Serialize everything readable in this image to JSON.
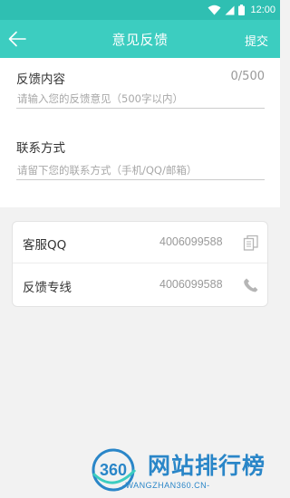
{
  "status_bar": {
    "time": "12:00",
    "icons": [
      "wifi-icon",
      "signal-icon",
      "battery-icon"
    ]
  },
  "app_bar": {
    "title": "意见反馈",
    "submit_label": "提交",
    "back_icon": "arrow-left-icon",
    "color": "#3ccdc0"
  },
  "form": {
    "feedback": {
      "label": "反馈内容",
      "counter": "0/500",
      "value": "",
      "placeholder": "请输入您的反馈意见（500字以内）"
    },
    "contact": {
      "label": "联系方式",
      "value": "",
      "placeholder": "请留下您的联系方式（手机/QQ/邮箱）"
    }
  },
  "contacts": [
    {
      "label": "客服QQ",
      "value": "4006099588",
      "icon": "copy-icon"
    },
    {
      "label": "反馈专线",
      "value": "4006099588",
      "icon": "phone-icon"
    }
  ],
  "watermark": {
    "logo_text": "360",
    "title": "网站排行榜",
    "subtitle": "-WANGZHAN360.CN-"
  }
}
